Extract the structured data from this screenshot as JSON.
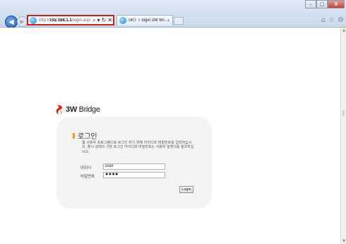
{
  "browser": {
    "url_prefix": "http://",
    "url_host": "192.168.1.1",
    "url_path": "/login.asp",
    "search_glyph": "⌕",
    "dropdown_glyph": "▾",
    "refresh_glyph": "↻",
    "stop_glyph": "✕",
    "tab_title": "SKT T login 3W Bri...",
    "tab_close": "×",
    "window": {
      "minimize": "–",
      "maximize": "□",
      "close": "X"
    },
    "toolbar_icons": {
      "home": "⌂",
      "favorites": "☆",
      "settings": "⚙"
    },
    "highlight_color": "#d41b1b"
  },
  "page": {
    "logo_text_bold": "3W",
    "logo_text": " Bridge",
    "login_title": "로그인",
    "description": "웹 사용자 프로그램으로 로그인 하기 위해 아이디와 비밀번호를 입력하십시오. 출시 상태의 기본 로그인 아이디와 비밀번호는 사용자 설명서를 참조하십시오.",
    "id_label": "아이디",
    "pw_label": "비밀번호",
    "id_value": "user",
    "pw_value": "●●●●",
    "login_button": "Login",
    "accent_color": "#f7941d"
  }
}
